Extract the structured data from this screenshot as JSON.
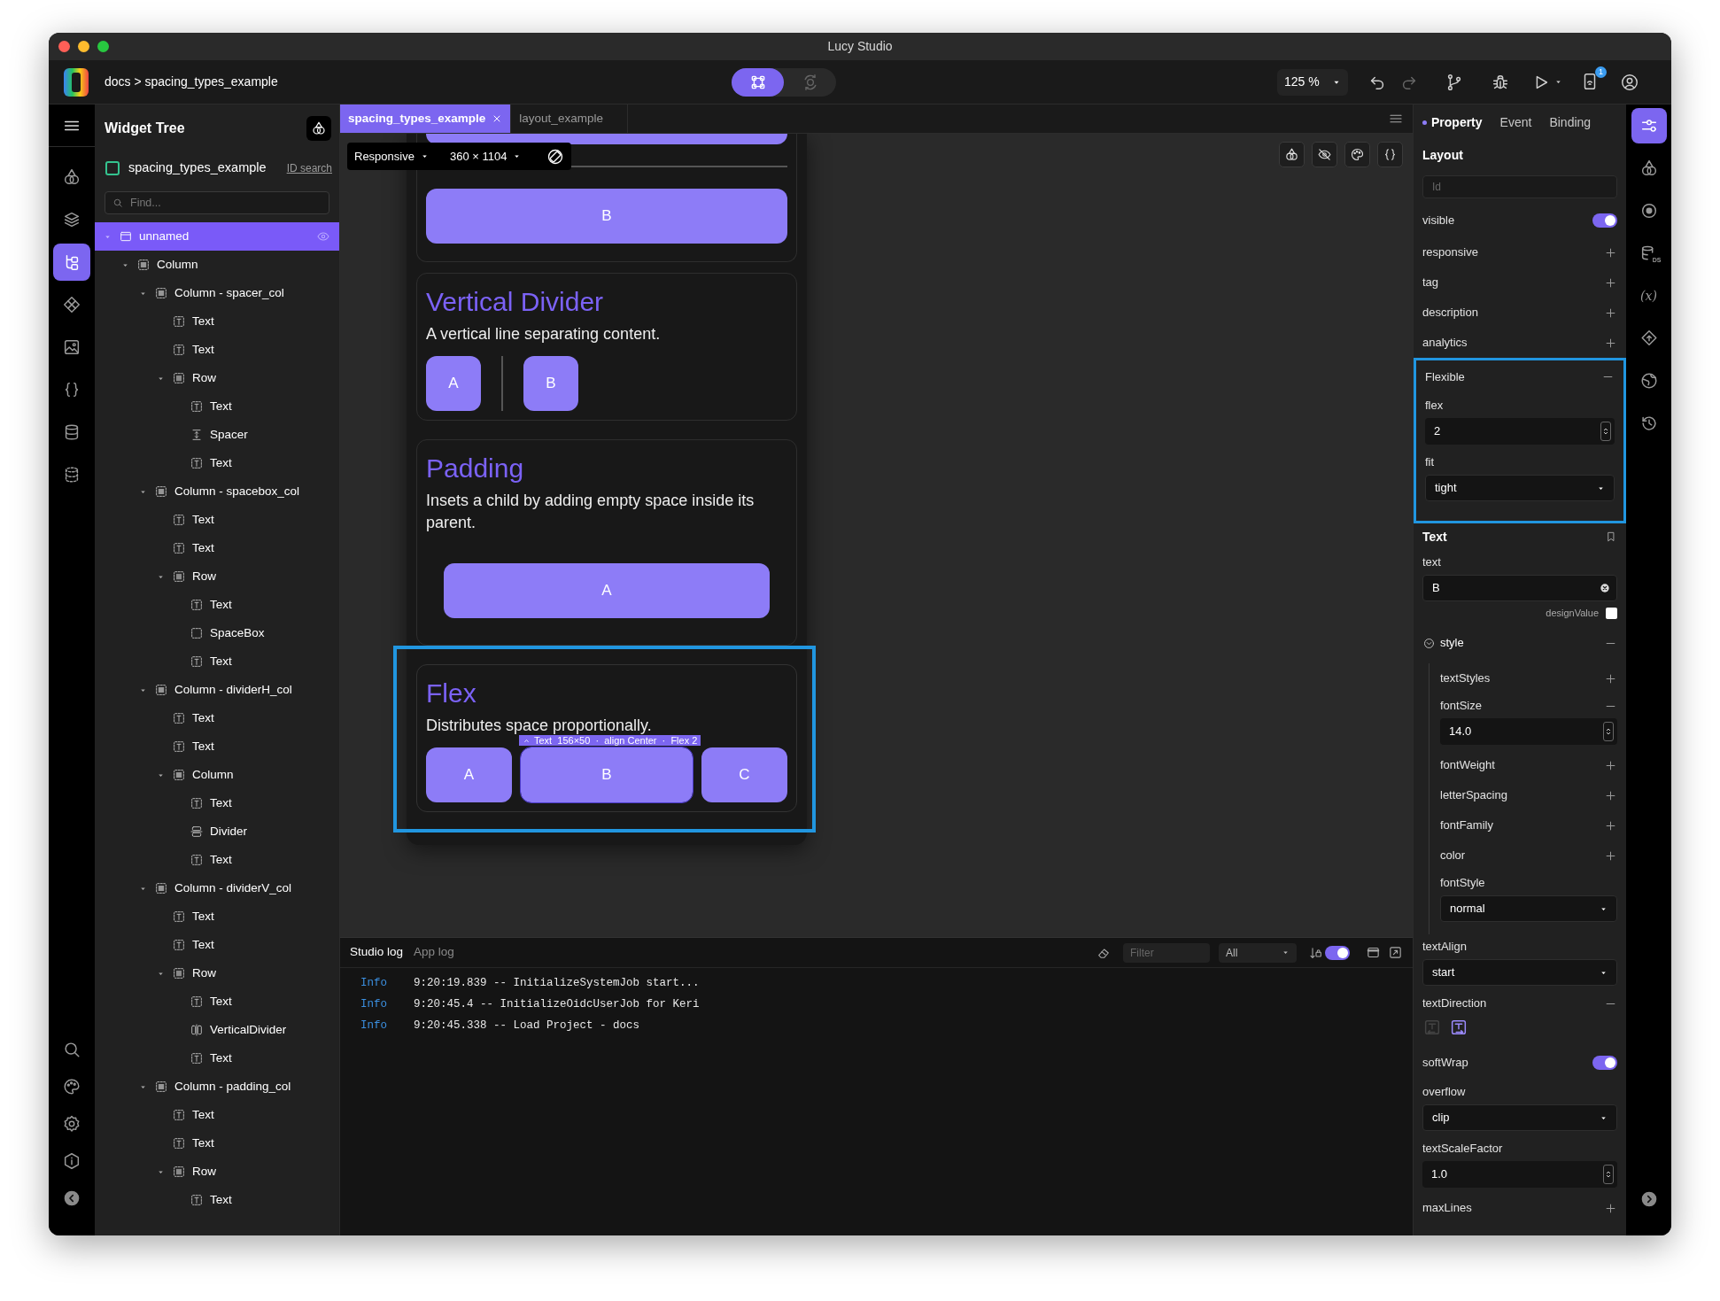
{
  "window": {
    "title": "Lucy Studio"
  },
  "toolbar": {
    "breadcrumb": "docs > spacing_types_example",
    "modes": [
      {
        "kind": "design",
        "selected": true
      },
      {
        "kind": "preview",
        "selected": false
      }
    ],
    "zoom": "125 %",
    "notification_count": "1"
  },
  "left_rail": {
    "top": [
      {
        "kind": "shapes",
        "selected": false
      },
      {
        "kind": "layers",
        "selected": false
      },
      {
        "kind": "tree",
        "selected": true
      },
      {
        "kind": "components",
        "selected": false
      },
      {
        "kind": "image",
        "selected": false
      },
      {
        "kind": "braces",
        "selected": false
      },
      {
        "kind": "database",
        "selected": false
      },
      {
        "kind": "dashed_database",
        "selected": false
      }
    ],
    "bottom": [
      {
        "kind": "search",
        "selected": false
      },
      {
        "kind": "palette",
        "selected": false
      },
      {
        "kind": "settings",
        "selected": false
      },
      {
        "kind": "info",
        "selected": false
      },
      {
        "kind": "collapse",
        "selected": false
      }
    ]
  },
  "widget_tree": {
    "title": "Widget Tree",
    "page": {
      "name": "spacing_types_example",
      "checked": false
    },
    "id_search": "ID search",
    "search": {
      "placeholder": "Find..."
    },
    "nodes": [
      {
        "label": "unnamed",
        "kind": "page",
        "selected": true,
        "expanded": true,
        "children": [
          {
            "label": "Column",
            "kind": "column",
            "selected": false,
            "expanded": true,
            "children": [
              {
                "label": "Column - spacer_col",
                "kind": "column",
                "selected": false,
                "expanded": true,
                "children": [
                  {
                    "label": "Text",
                    "kind": "text",
                    "selected": false
                  },
                  {
                    "label": "Text",
                    "kind": "text",
                    "selected": false
                  },
                  {
                    "label": "Row",
                    "kind": "row",
                    "selected": false,
                    "expanded": true,
                    "children": [
                      {
                        "label": "Text",
                        "kind": "text",
                        "selected": false
                      },
                      {
                        "label": "Spacer",
                        "kind": "spacer",
                        "selected": false
                      },
                      {
                        "label": "Text",
                        "kind": "text",
                        "selected": false
                      }
                    ]
                  }
                ]
              },
              {
                "label": "Column - spacebox_col",
                "kind": "column",
                "selected": false,
                "expanded": true,
                "children": [
                  {
                    "label": "Text",
                    "kind": "text",
                    "selected": false
                  },
                  {
                    "label": "Text",
                    "kind": "text",
                    "selected": false
                  },
                  {
                    "label": "Row",
                    "kind": "row",
                    "selected": false,
                    "expanded": true,
                    "children": [
                      {
                        "label": "Text",
                        "kind": "text",
                        "selected": false
                      },
                      {
                        "label": "SpaceBox",
                        "kind": "spacebox",
                        "selected": false
                      },
                      {
                        "label": "Text",
                        "kind": "text",
                        "selected": false
                      }
                    ]
                  }
                ]
              },
              {
                "label": "Column - dividerH_col",
                "kind": "column",
                "selected": false,
                "expanded": true,
                "children": [
                  {
                    "label": "Text",
                    "kind": "text",
                    "selected": false
                  },
                  {
                    "label": "Text",
                    "kind": "text",
                    "selected": false
                  },
                  {
                    "label": "Column",
                    "kind": "column",
                    "selected": false,
                    "expanded": true,
                    "children": [
                      {
                        "label": "Text",
                        "kind": "text",
                        "selected": false
                      },
                      {
                        "label": "Divider",
                        "kind": "divider",
                        "selected": false
                      },
                      {
                        "label": "Text",
                        "kind": "text",
                        "selected": false
                      }
                    ]
                  }
                ]
              },
              {
                "label": "Column - dividerV_col",
                "kind": "column",
                "selected": false,
                "expanded": true,
                "children": [
                  {
                    "label": "Text",
                    "kind": "text",
                    "selected": false
                  },
                  {
                    "label": "Text",
                    "kind": "text",
                    "selected": false
                  },
                  {
                    "label": "Row",
                    "kind": "row",
                    "selected": false,
                    "expanded": true,
                    "children": [
                      {
                        "label": "Text",
                        "kind": "text",
                        "selected": false
                      },
                      {
                        "label": "VerticalDivider",
                        "kind": "vertical_divider",
                        "selected": false
                      },
                      {
                        "label": "Text",
                        "kind": "text",
                        "selected": false
                      }
                    ]
                  }
                ]
              },
              {
                "label": "Column - padding_col",
                "kind": "column",
                "selected": false,
                "expanded": true,
                "children": [
                  {
                    "label": "Text",
                    "kind": "text",
                    "selected": false
                  },
                  {
                    "label": "Text",
                    "kind": "text",
                    "selected": false
                  },
                  {
                    "label": "Row",
                    "kind": "row",
                    "selected": false,
                    "expanded": true,
                    "children": [
                      {
                        "label": "Text",
                        "kind": "text",
                        "selected": false
                      }
                    ]
                  }
                ]
              }
            ]
          }
        ]
      }
    ]
  },
  "tabs": [
    {
      "label": "spacing_types_example",
      "selected": true,
      "closable": true
    },
    {
      "label": "layout_example",
      "selected": false,
      "closable": false
    }
  ],
  "canvas": {
    "device_mode": "Responsive",
    "device_size": "360 × 1104",
    "cards": [
      {
        "kind": "horizontal_divider",
        "buttons": [
          {
            "label": "B",
            "selected": false
          }
        ]
      },
      {
        "kind": "vertical_divider",
        "title": "Vertical Divider",
        "description": "A vertical line separating content.",
        "buttons": [
          {
            "label": "A",
            "selected": false
          },
          {
            "label": "B",
            "selected": false
          }
        ]
      },
      {
        "kind": "padding",
        "title": "Padding",
        "description": "Insets a child by adding empty space inside its parent.",
        "buttons": [
          {
            "label": "A",
            "selected": false
          }
        ]
      },
      {
        "kind": "flex",
        "title": "Flex",
        "description": "Distributes space proportionally.",
        "highlighted": true,
        "buttons": [
          {
            "label": "A",
            "selected": false
          },
          {
            "label": "B",
            "selected": true
          },
          {
            "label": "C",
            "selected": false
          }
        ]
      }
    ],
    "selection_label": "Text  156×50  ·  align Center  ·  Flex 2"
  },
  "log": {
    "tabs": [
      {
        "label": "Studio log",
        "selected": true
      },
      {
        "label": "App log",
        "selected": false
      }
    ],
    "filter": {
      "placeholder": "Filter"
    },
    "level_filter": "All",
    "autoscroll": true,
    "entries": [
      {
        "level": "Info",
        "message": "9:20:19.839 -- InitializeSystemJob start..."
      },
      {
        "level": "Info",
        "message": "9:20:45.4 -- InitializeOidcUserJob for Keri"
      },
      {
        "level": "Info",
        "message": "9:20:45.338 -- Load Project - docs"
      }
    ]
  },
  "properties": {
    "tabs": [
      {
        "label": "Property",
        "selected": true
      },
      {
        "label": "Event",
        "selected": false
      },
      {
        "label": "Binding",
        "selected": false
      }
    ],
    "sections": [
      {
        "kind": "section",
        "title": "Layout",
        "pinnable": false,
        "rows": [
          {
            "kind": "field",
            "placeholder": "Id"
          },
          {
            "kind": "toggle",
            "label": "visible",
            "on": true
          },
          {
            "kind": "add",
            "label": "responsive"
          },
          {
            "kind": "add",
            "label": "tag"
          },
          {
            "kind": "add",
            "label": "description"
          },
          {
            "kind": "add",
            "label": "analytics"
          }
        ]
      },
      {
        "kind": "group",
        "title": "Flexible",
        "highlighted": true,
        "rows": [
          {
            "kind": "number",
            "label": "flex",
            "value": "2",
            "collapsible": false
          },
          {
            "kind": "select",
            "label": "fit",
            "value": "tight"
          }
        ]
      },
      {
        "kind": "section",
        "title": "Text",
        "pinnable": true,
        "rows": [
          {
            "kind": "text",
            "label": "text",
            "value": "B"
          },
          {
            "kind": "checkbox",
            "label": "designValue",
            "checked": false
          },
          {
            "kind": "nested",
            "label": "style",
            "expanded": true,
            "rows": [
              {
                "kind": "add",
                "label": "textStyles"
              },
              {
                "kind": "number",
                "label": "fontSize",
                "value": "14.0",
                "collapsible": true
              },
              {
                "kind": "add",
                "label": "fontWeight"
              },
              {
                "kind": "add",
                "label": "letterSpacing"
              },
              {
                "kind": "add",
                "label": "fontFamily"
              },
              {
                "kind": "add",
                "label": "color"
              },
              {
                "kind": "select",
                "label": "fontStyle",
                "value": "normal"
              }
            ]
          },
          {
            "kind": "select",
            "label": "textAlign",
            "value": "start"
          },
          {
            "kind": "direction",
            "label": "textDirection",
            "options": [
              {
                "kind": "rtl",
                "selected": false
              },
              {
                "kind": "ltr",
                "selected": true
              }
            ]
          },
          {
            "kind": "toggle",
            "label": "softWrap",
            "on": true
          },
          {
            "kind": "select",
            "label": "overflow",
            "value": "clip"
          },
          {
            "kind": "number",
            "label": "textScaleFactor",
            "value": "1.0",
            "collapsible": false
          },
          {
            "kind": "add",
            "label": "maxLines"
          }
        ]
      }
    ]
  },
  "right_rail": {
    "items": [
      {
        "kind": "properties",
        "selected": true
      },
      {
        "kind": "shapes",
        "selected": false
      },
      {
        "kind": "target",
        "selected": false
      },
      {
        "kind": "data",
        "badge": "DS",
        "selected": false
      },
      {
        "kind": "variables",
        "glyph": "(x)",
        "selected": false
      },
      {
        "kind": "diamond_arrow",
        "selected": false
      },
      {
        "kind": "globe",
        "selected": false
      },
      {
        "kind": "history",
        "selected": false
      }
    ],
    "bottom": [
      {
        "kind": "expand"
      }
    ]
  }
}
